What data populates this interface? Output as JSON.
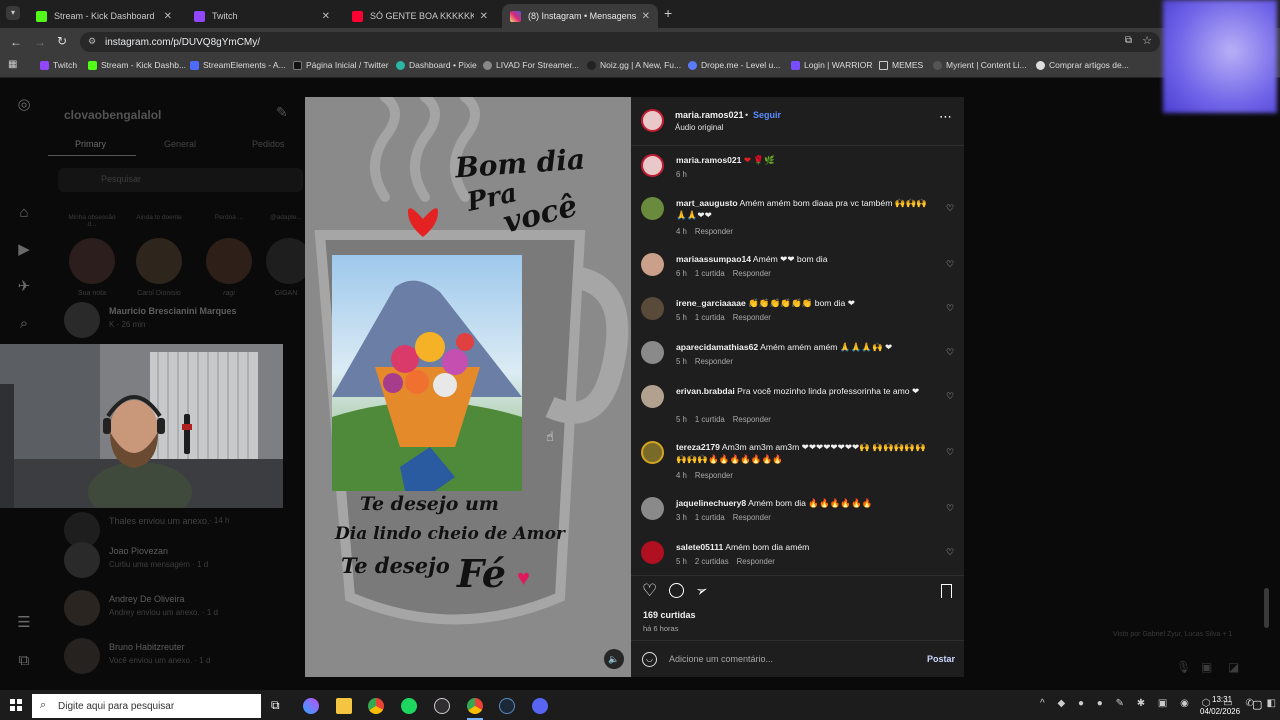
{
  "browser": {
    "tabs": [
      {
        "title": "Stream - Kick Dashboard",
        "color": "#53fc18"
      },
      {
        "title": "Twitch",
        "color": "#9146ff"
      },
      {
        "title": "SÓ GENTE BOA KKKKKKKK - Yo",
        "color": "#ff0033"
      },
      {
        "title": "(8) Instagram • Mensagens",
        "color": "#d6249f"
      }
    ],
    "url": "instagram.com/p/DUVQ8gYmCMy/",
    "bookmarks": [
      "Twitch",
      "Stream - Kick Dashb...",
      "StreamElements - A...",
      "Página Inicial / Twitter",
      "Dashboard • Pixie",
      "LIVAD For Streamer...",
      "Noiz.gg | A New, Fu...",
      "Drope.me - Level u...",
      "Login | WARRIOR",
      "MEMES",
      "Myrient | Content Li...",
      "Comprar artigos de..."
    ]
  },
  "dm": {
    "username": "clovaobengalalol",
    "tabs": [
      "Primary",
      "General",
      "Pedidos"
    ],
    "search_placeholder": "Pesquisar",
    "notes": [
      {
        "caption": "Sua nota",
        "top": "Minha obsessão d..."
      },
      {
        "caption": "Carol Dionisio",
        "top": "Ainda to doente"
      },
      {
        "caption": "ragi",
        "top": "Perdoa ..."
      },
      {
        "caption": "GIGAN",
        "top": "@adapte..."
      }
    ],
    "threads": [
      {
        "name": "Mauricio Brescianini Marques",
        "sub": "K · 26 min"
      },
      {
        "name": "Thales enviou um anexo.",
        "sub": "· 14 h"
      },
      {
        "name": "Joao Piovezan",
        "sub": "Curtiu uma mensagem · 1 d"
      },
      {
        "name": "Andrey De Oliveira",
        "sub": "Andrey enviou um anexo. · 1 d"
      },
      {
        "name": "Bruno Habitzreuter",
        "sub": "Você enviou um anexo. · 1 d"
      }
    ]
  },
  "post": {
    "author": "maria.ramos021",
    "follow": "Seguir",
    "audio": "Áudio original",
    "caption_emojis": "❤ 🌹🌿",
    "caption_time": "6 h",
    "image_text": {
      "line1": "Bom dia",
      "line2": "Pra",
      "line3": "você",
      "line4": "Te desejo um",
      "line5": "Dia lindo cheio de Amor",
      "line6": "Te desejo",
      "line7": "Fé"
    },
    "comments": [
      {
        "user": "mart_aaugusto",
        "text": "Amém amém bom diaaa pra vc também 🙌🙌🙌 🙏🙏❤❤",
        "time": "4 h",
        "likes": "",
        "reply": "Responder",
        "color": "#6a8a3e"
      },
      {
        "user": "mariaassumpao14",
        "text": "Amém ❤❤ bom dia",
        "time": "6 h",
        "likes": "1 curtida",
        "reply": "Responder",
        "color": "#caa08a"
      },
      {
        "user": "irene_garciaaaae",
        "text": "👏👏👏👏👏👏 bom dia ❤",
        "time": "5 h",
        "likes": "1 curtida",
        "reply": "Responder",
        "color": "#5a4a3a"
      },
      {
        "user": "aparecidamathias62",
        "text": "Amém amém amém 🙏🙏🙏🙌 ❤",
        "time": "5 h",
        "likes": "",
        "reply": "Responder",
        "color": "#8a8a8a"
      },
      {
        "user": "erivan.brabdai",
        "text": "Pra você mozinho linda professorinha te amo ❤",
        "time": "5 h",
        "likes": "1 curtida",
        "reply": "Responder",
        "color": "#b3a190"
      },
      {
        "user": "tereza2179",
        "text": "Am3m am3m am3m ❤❤❤❤❤❤❤❤🙌 🙌🙌🙌🙌🙌🙌🙌🙌🔥🔥🔥🔥🔥🔥🔥",
        "time": "4 h",
        "likes": "",
        "reply": "Responder",
        "color": "#7a6a2a"
      },
      {
        "user": "jaquelinechuery8",
        "text": "Amém bom dia 🔥🔥🔥🔥🔥🔥",
        "time": "3 h",
        "likes": "1 curtida",
        "reply": "Responder",
        "color": "#8a8a8a"
      },
      {
        "user": "salete05111",
        "text": "Amém bom dia amém",
        "time": "5 h",
        "likes": "2 curtidas",
        "reply": "Responder",
        "color": "#b01020"
      }
    ],
    "like_count": "169 curtidas",
    "posted_ago": "há 6 horas",
    "comment_placeholder": "Adicione um comentário...",
    "post_button": "Postar"
  },
  "right_panel": {
    "seen_by": "Visto por Gabriel Zyur, Lucas Silva + 1"
  },
  "taskbar": {
    "search_placeholder": "Digite aqui para pesquisar",
    "time": "13:31",
    "date": "04/02/2026"
  },
  "colors": {
    "instagram_link": "#0095f6",
    "kick_green": "#53fc18",
    "twitch_purple": "#9146ff"
  }
}
